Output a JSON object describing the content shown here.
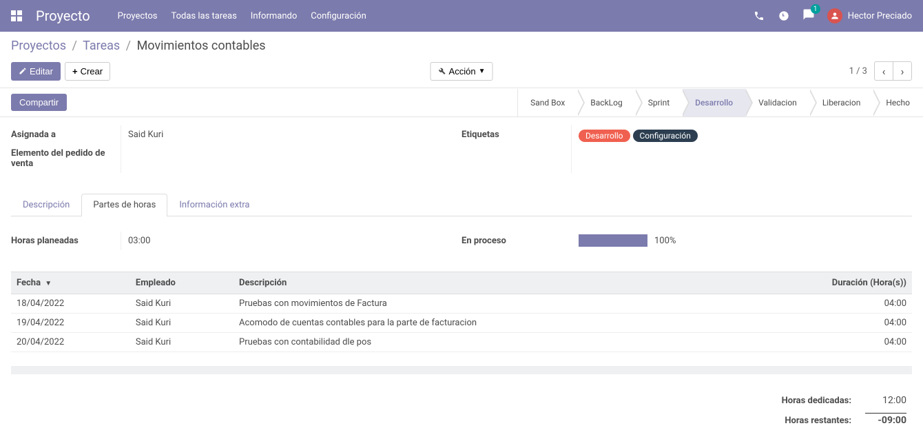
{
  "navbar": {
    "title": "Proyecto",
    "menu": [
      "Proyectos",
      "Todas las tareas",
      "Informando",
      "Configuración"
    ],
    "message_count": "1",
    "username": "Hector Preciado"
  },
  "breadcrumb": {
    "items": [
      "Proyectos",
      "Tareas"
    ],
    "current": "Movimientos contables"
  },
  "buttons": {
    "edit": "Editar",
    "create": "Crear",
    "action": "Acción",
    "share": "Compartir"
  },
  "pager": {
    "text": "1 / 3"
  },
  "stages": {
    "items": [
      "Sand Box",
      "BackLog",
      "Sprint",
      "Desarrollo",
      "Validacion",
      "Liberacion",
      "Hecho"
    ],
    "active_index": 3
  },
  "fields": {
    "assigned_label": "Asignada a",
    "assigned_value": "Said Kuri",
    "so_item_label": "Elemento del pedido de venta",
    "tags_label": "Etiquetas",
    "tags": [
      {
        "text": "Desarrollo",
        "cls": "tag-red"
      },
      {
        "text": "Configuración",
        "cls": "tag-dark"
      }
    ]
  },
  "tabs": {
    "items": [
      "Descripción",
      "Partes de horas",
      "Información extra"
    ],
    "active_index": 1
  },
  "timesheet": {
    "planned_label": "Horas planeadas",
    "planned_value": "03:00",
    "progress_label": "En proceso",
    "progress_pct": "100%",
    "columns": {
      "date": "Fecha",
      "employee": "Empleado",
      "description": "Descripción",
      "duration": "Duración (Hora(s))"
    },
    "rows": [
      {
        "date": "18/04/2022",
        "employee": "Said Kuri",
        "description": "Pruebas con movimientos de Factura",
        "duration": "04:00"
      },
      {
        "date": "19/04/2022",
        "employee": "Said Kuri",
        "description": "Acomodo de cuentas contables para la parte de facturacion",
        "duration": "04:00"
      },
      {
        "date": "20/04/2022",
        "employee": "Said Kuri",
        "description": "Pruebas con contabilidad dle pos",
        "duration": "04:00"
      }
    ],
    "totals": {
      "dedicated_label": "Horas dedicadas:",
      "dedicated_value": "12:00",
      "remaining_label": "Horas restantes:",
      "remaining_value": "-09:00"
    }
  }
}
